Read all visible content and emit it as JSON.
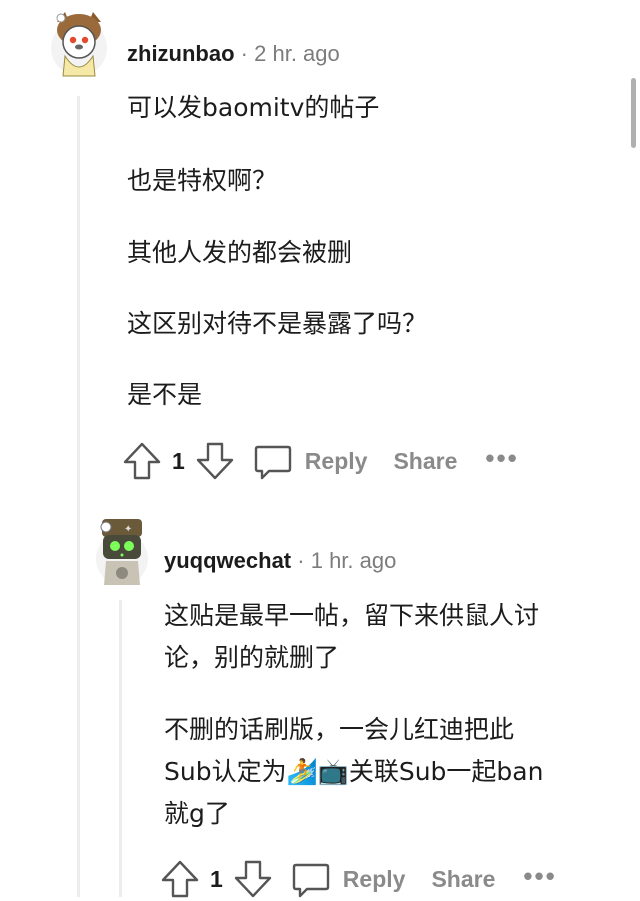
{
  "comments": [
    {
      "username": "zhizunbao",
      "separator": "·",
      "time": "2 hr. ago",
      "paragraphs": [
        "可以发baomitv的帖子",
        "也是特权啊？",
        "其他人发的都会被删",
        "这区别对待不是暴露了吗？",
        "是不是"
      ],
      "score": "1",
      "reply_label": "Reply",
      "share_label": "Share",
      "more_label": "•••"
    },
    {
      "username": "yuqqwechat",
      "separator": "·",
      "time": "1 hr. ago",
      "paragraphs": [
        "这贴是最早一帖，留下来供鼠人讨",
        "论，别的就删了",
        "不删的话刷版，一会儿红迪把此",
        "Sub认定为🏄📺关联Sub一起ban",
        "就g了"
      ],
      "score": "1",
      "reply_label": "Reply",
      "share_label": "Share",
      "more_label": "•••"
    }
  ],
  "icons": [
    "upvote-icon",
    "downvote-icon",
    "comment-bubble-icon",
    "surfer-emoji-icon",
    "tv-emoji-icon"
  ],
  "colors": {
    "muted": "#7c7c7c",
    "action": "#8a8a8a",
    "thread_line": "#ededed",
    "text": "#1c1c1c"
  }
}
